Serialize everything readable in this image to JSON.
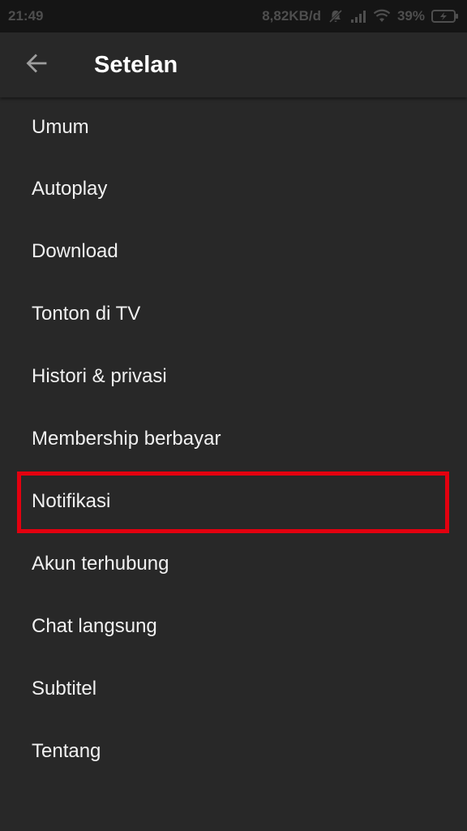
{
  "status_bar": {
    "time": "21:49",
    "net_speed": "8,82KB/d",
    "battery": "39%",
    "icons": [
      "mute-icon",
      "signal-icon",
      "wifi-icon",
      "battery-charging-icon"
    ]
  },
  "app_bar": {
    "back_icon": "arrow-back-icon",
    "title": "Setelan"
  },
  "settings": {
    "items": [
      {
        "label": "Umum"
      },
      {
        "label": "Autoplay"
      },
      {
        "label": "Download"
      },
      {
        "label": "Tonton di TV"
      },
      {
        "label": "Histori & privasi"
      },
      {
        "label": "Membership berbayar"
      },
      {
        "label": "Notifikasi"
      },
      {
        "label": "Akun terhubung"
      },
      {
        "label": "Chat langsung"
      },
      {
        "label": "Subtitel"
      },
      {
        "label": "Tentang"
      }
    ]
  },
  "annotation": {
    "highlighted_item": "Notifikasi",
    "color": "#e3000f"
  },
  "colors": {
    "background": "#282828",
    "status_bar": "#151515",
    "text": "#f1f1f1"
  }
}
